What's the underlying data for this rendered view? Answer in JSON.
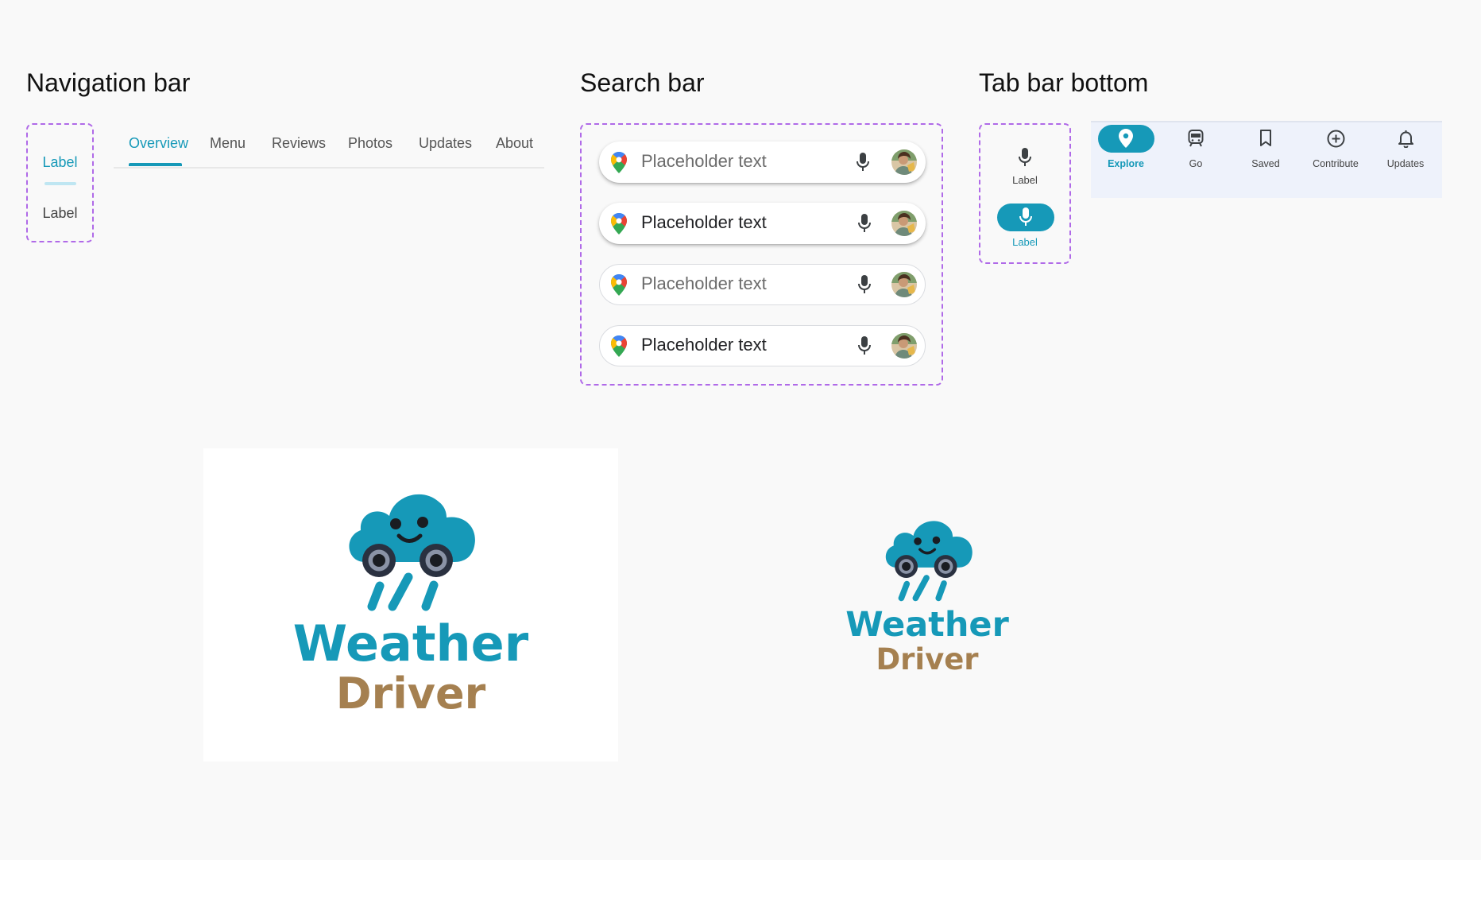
{
  "sections": {
    "navigation_bar": "Navigation bar",
    "search_bar": "Search bar",
    "tab_bar_bottom": "Tab bar bottom"
  },
  "nav_rail": {
    "active_label": "Label",
    "inactive_label": "Label"
  },
  "top_tabs": {
    "items": [
      "Overview",
      "Menu",
      "Reviews",
      "Photos",
      "Updates",
      "About"
    ],
    "active_index": 0
  },
  "search": {
    "placeholder": "Placeholder text",
    "variants": [
      "elevated-grey",
      "elevated-dark",
      "outlined-grey",
      "outlined-dark"
    ]
  },
  "tab_rail": {
    "top_label": "Label",
    "selected_label": "Label"
  },
  "bottom_bar": {
    "items": [
      {
        "label": "Explore",
        "icon": "location-pin-icon"
      },
      {
        "label": "Go",
        "icon": "transit-icon"
      },
      {
        "label": "Saved",
        "icon": "bookmark-icon"
      },
      {
        "label": "Contribute",
        "icon": "add-circle-icon"
      },
      {
        "label": "Updates",
        "icon": "bell-icon"
      }
    ],
    "active_index": 0
  },
  "logo": {
    "line1": "Weather",
    "line2": "Driver"
  },
  "colors": {
    "accent": "#1699b8",
    "logo_brown": "#a58050",
    "dashed_border": "#b06ae8",
    "background": "#f9f9f9"
  }
}
